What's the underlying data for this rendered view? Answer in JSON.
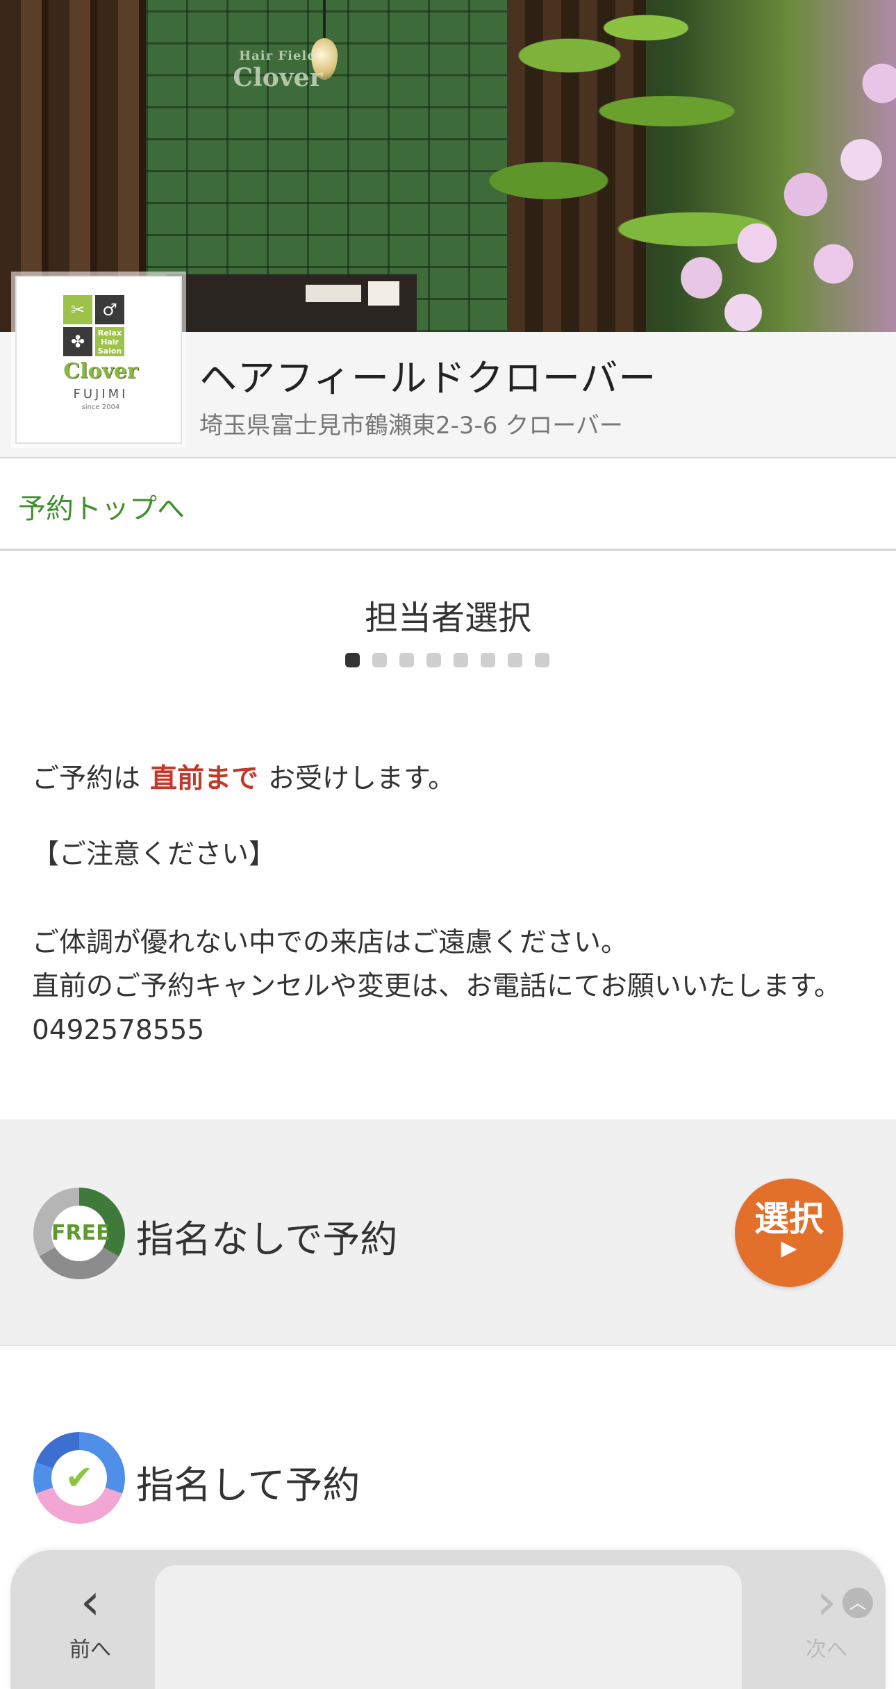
{
  "shop": {
    "name": "ヘアフィールドクローバー",
    "address": "埼玉県富士見市鶴瀬東2-3-6  クローバー",
    "logo": {
      "line1": "Clover",
      "line2": "FUJIMI",
      "since": "since 2004",
      "sign_small": "Hair Field",
      "sign_large": "Clover"
    }
  },
  "nav": {
    "back_label": "予約トップへ"
  },
  "step": {
    "title": "担当者選択",
    "total_steps": 8,
    "current_step": 1
  },
  "notice": {
    "lead_before": "ご予約は",
    "lead_accent": "直前まで",
    "lead_after": "お受けします。",
    "caution_title": "【ご注意ください】",
    "line1": "ご体調が優れない中での来店はご遠慮ください。",
    "line2": "直前のご予約キャンセルや変更は、お電話にてお願いいたします。",
    "phone": "0492578555"
  },
  "options": {
    "free": {
      "badge": "FREE",
      "label": "指名なしで予約",
      "button_label": "選択",
      "button_arrow": "▶"
    },
    "named": {
      "badge": "✔",
      "label": "指名して予約"
    }
  },
  "toolbar": {
    "prev_label": "前へ",
    "next_label": "次へ",
    "prev_icon": "chevron-left-icon",
    "next_icon": "chevron-right-icon",
    "collapse_icon": "chevron-up-icon"
  },
  "colors": {
    "accent_green": "#3f8f2a",
    "accent_red": "#c0392b",
    "button_orange": "#e2702b"
  }
}
